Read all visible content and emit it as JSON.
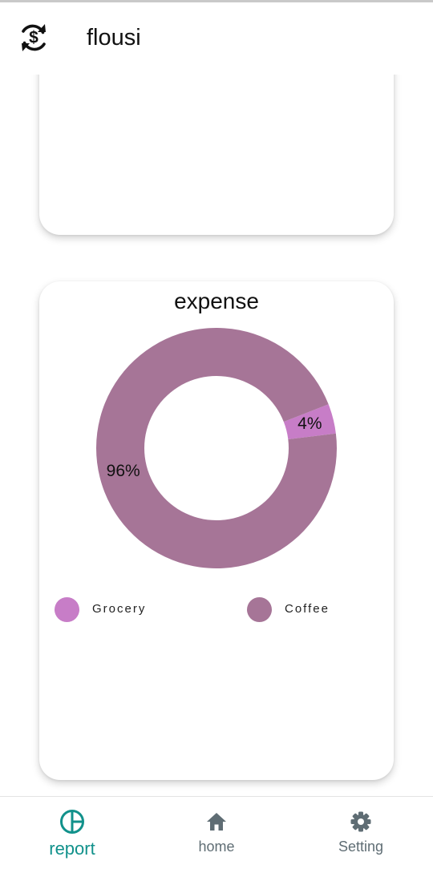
{
  "app_bar": {
    "title": "flousi",
    "icon": "currency-exchange-icon"
  },
  "expense_card": {
    "title": "expense",
    "chart_data": {
      "type": "pie",
      "style": "donut",
      "title": "expense",
      "slices": [
        {
          "name": "Grocery",
          "value": 4,
          "label": "4%",
          "color": "#c77dc7"
        },
        {
          "name": "Coffee",
          "value": 96,
          "label": "96%",
          "color": "#a67597"
        }
      ],
      "legend": [
        "Grocery",
        "Coffee"
      ],
      "legend_position": "bottom"
    }
  },
  "colors": {
    "accent": "#11918b",
    "nav_inactive": "#5f6d74",
    "grocery": "#c77dc7",
    "coffee": "#a67597"
  },
  "bottom_nav": {
    "items": [
      {
        "label": "report",
        "icon": "pie-chart-icon",
        "active": true
      },
      {
        "label": "home",
        "icon": "home-icon",
        "active": false
      },
      {
        "label": "Setting",
        "icon": "gear-icon",
        "active": false
      }
    ]
  }
}
